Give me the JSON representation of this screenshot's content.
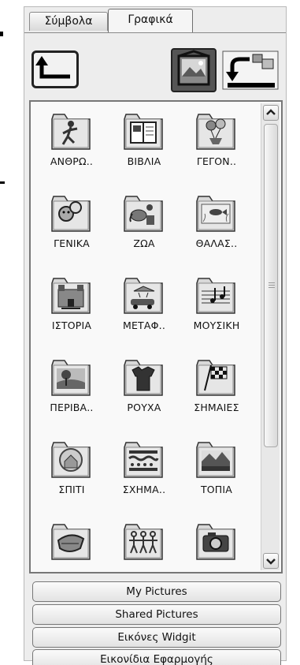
{
  "tabs": [
    {
      "label": "Σύμβολα",
      "active": false
    },
    {
      "label": "Γραφικά",
      "active": true
    }
  ],
  "toolbar": {
    "up_icon": "folder-up-icon",
    "picture_icon": "picture-view-icon",
    "swap_icon": "swap-images-icon"
  },
  "grid": {
    "items": [
      {
        "label": "ΑΝΘΡΩ..",
        "icon": "running-person-icon"
      },
      {
        "label": "ΒΙΒΛΙΑ",
        "icon": "book-icon"
      },
      {
        "label": "ΓΕΓΟΝ..",
        "icon": "party-balloons-icon"
      },
      {
        "label": "ΓΕΝΙΚΑ",
        "icon": "faces-icon"
      },
      {
        "label": "ΖΩΑ",
        "icon": "animals-icon"
      },
      {
        "label": "ΘΑΛΑΣ..",
        "icon": "sea-fish-icon"
      },
      {
        "label": "ΙΣΤΟΡΙΑ",
        "icon": "castle-icon"
      },
      {
        "label": "ΜΕΤΑΦ..",
        "icon": "vehicles-icon"
      },
      {
        "label": "ΜΟΥΣΙΚΗ",
        "icon": "music-notes-icon"
      },
      {
        "label": "ΠΕΡΙΒΑ..",
        "icon": "landscape-tree-icon"
      },
      {
        "label": "ΡΟΥΧΑ",
        "icon": "clothes-icon"
      },
      {
        "label": "ΣΗΜΑΙΕΣ",
        "icon": "checkered-flag-icon"
      },
      {
        "label": "ΣΠΙΤΙ",
        "icon": "house-icon"
      },
      {
        "label": "ΣΧΗΜΑ..",
        "icon": "waves-pattern-icon"
      },
      {
        "label": "ΤΟΠΙΑ",
        "icon": "mountain-landscape-icon"
      },
      {
        "label": "",
        "icon": "food-icon"
      },
      {
        "label": "",
        "icon": "people-chain-icon"
      },
      {
        "label": "",
        "icon": "camera-icon"
      }
    ]
  },
  "buttons": {
    "my_pictures": "My Pictures",
    "shared_pictures": "Shared Pictures",
    "widgit": "Εικόνες Widgit",
    "app_icons": "Εικονίδια Εφαρμογής"
  }
}
